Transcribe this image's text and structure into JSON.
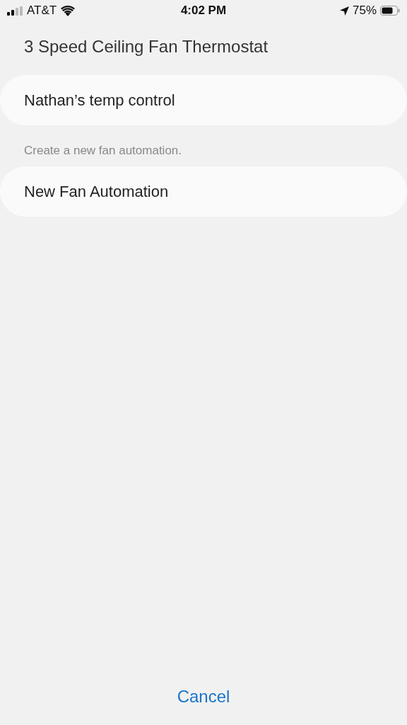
{
  "status_bar": {
    "carrier": "AT&T",
    "time": "4:02 PM",
    "battery": "75%"
  },
  "title": "3 Speed Ceiling Fan Thermostat",
  "automations": [
    {
      "label": "Nathan’s temp control"
    }
  ],
  "hint": "Create a new fan automation.",
  "new_button": "New Fan Automation",
  "cancel_button": "Cancel"
}
